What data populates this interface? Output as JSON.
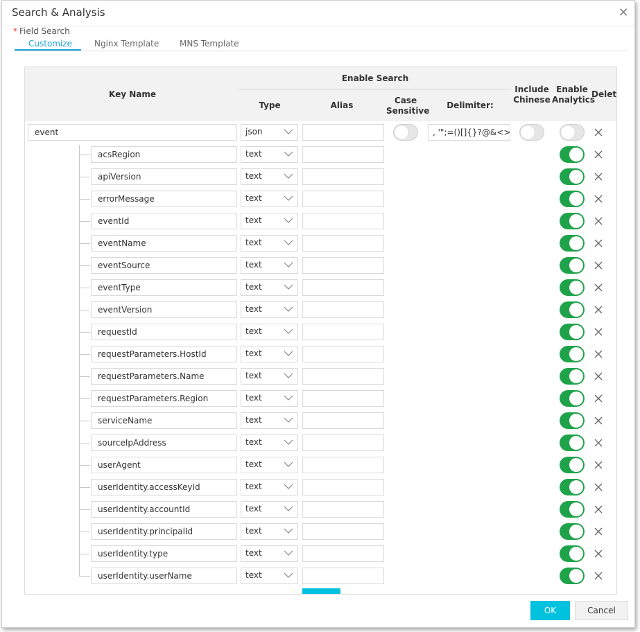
{
  "dialog": {
    "title": "Search & Analysis",
    "field_search_label": "Field Search",
    "required_mark": "*"
  },
  "tabs": [
    {
      "label": "Customize",
      "active": true
    },
    {
      "label": "Nginx Template",
      "active": false
    },
    {
      "label": "MNS Template",
      "active": false
    }
  ],
  "headers": {
    "key_name": "Key Name",
    "enable_search": "Enable Search",
    "type": "Type",
    "alias": "Alias",
    "case_sensitive": "Case Sensitive",
    "delimiter": "Delimiter:",
    "include_chinese": "Include Chinese",
    "enable_analytics": "Enable Analytics",
    "delete": "Delete"
  },
  "parent_field": {
    "key": "event",
    "type": "json",
    "alias": "",
    "case_sensitive": false,
    "delimiter": ", '\";=()[]{}?@&<>/:\\",
    "include_chinese": false,
    "enable_analytics": false
  },
  "fields": [
    {
      "key": "acsRegion",
      "type": "text",
      "alias": "",
      "enable_analytics": true
    },
    {
      "key": "apiVersion",
      "type": "text",
      "alias": "",
      "enable_analytics": true
    },
    {
      "key": "errorMessage",
      "type": "text",
      "alias": "",
      "enable_analytics": true
    },
    {
      "key": "eventId",
      "type": "text",
      "alias": "",
      "enable_analytics": true
    },
    {
      "key": "eventName",
      "type": "text",
      "alias": "",
      "enable_analytics": true
    },
    {
      "key": "eventSource",
      "type": "text",
      "alias": "",
      "enable_analytics": true
    },
    {
      "key": "eventType",
      "type": "text",
      "alias": "",
      "enable_analytics": true
    },
    {
      "key": "eventVersion",
      "type": "text",
      "alias": "",
      "enable_analytics": true
    },
    {
      "key": "requestId",
      "type": "text",
      "alias": "",
      "enable_analytics": true
    },
    {
      "key": "requestParameters.HostId",
      "type": "text",
      "alias": "",
      "enable_analytics": true
    },
    {
      "key": "requestParameters.Name",
      "type": "text",
      "alias": "",
      "enable_analytics": true
    },
    {
      "key": "requestParameters.Region",
      "type": "text",
      "alias": "",
      "enable_analytics": true
    },
    {
      "key": "serviceName",
      "type": "text",
      "alias": "",
      "enable_analytics": true
    },
    {
      "key": "sourceIpAddress",
      "type": "text",
      "alias": "",
      "enable_analytics": true
    },
    {
      "key": "userAgent",
      "type": "text",
      "alias": "",
      "enable_analytics": true
    },
    {
      "key": "userIdentity.accessKeyId",
      "type": "text",
      "alias": "",
      "enable_analytics": true
    },
    {
      "key": "userIdentity.accountId",
      "type": "text",
      "alias": "",
      "enable_analytics": true
    },
    {
      "key": "userIdentity.principalId",
      "type": "text",
      "alias": "",
      "enable_analytics": true
    },
    {
      "key": "userIdentity.type",
      "type": "text",
      "alias": "",
      "enable_analytics": true
    },
    {
      "key": "userIdentity.userName",
      "type": "text",
      "alias": "",
      "enable_analytics": true
    }
  ],
  "buttons": {
    "ok": "OK",
    "cancel": "Cancel"
  },
  "colors": {
    "accent": "#00c1de",
    "tab_active": "#1aa4d6",
    "toggle_on": "#1fa34a",
    "required": "#e5382c"
  },
  "icons": {
    "close": "close-icon",
    "delete": "delete-x-icon",
    "dropdown": "chevron-down-icon"
  }
}
